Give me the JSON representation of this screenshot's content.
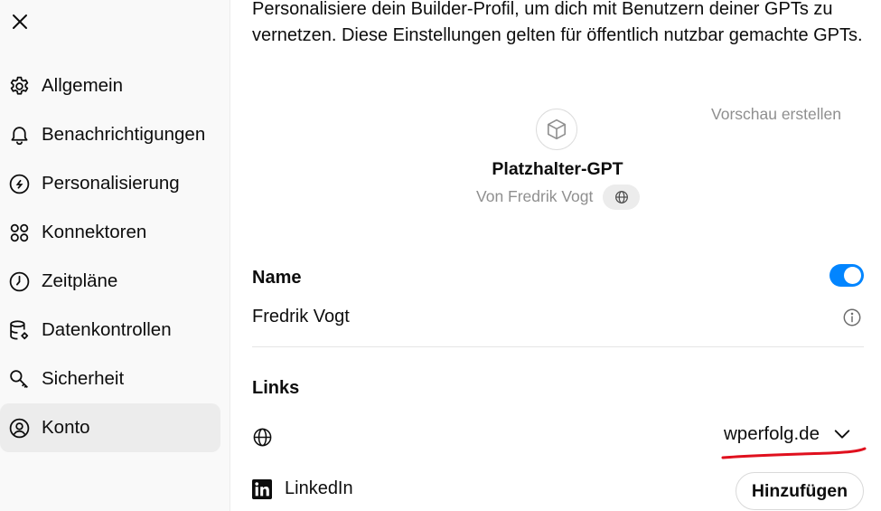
{
  "dialog": {
    "close_icon": "close-icon"
  },
  "sidebar": {
    "items": [
      {
        "label": "Allgemein",
        "icon": "gear-icon"
      },
      {
        "label": "Benachrichtigungen",
        "icon": "bell-icon"
      },
      {
        "label": "Personalisierung",
        "icon": "personalization-icon"
      },
      {
        "label": "Konnektoren",
        "icon": "connectors-icon"
      },
      {
        "label": "Zeitpläne",
        "icon": "clock-icon"
      },
      {
        "label": "Datenkontrollen",
        "icon": "database-gear-icon"
      },
      {
        "label": "Sicherheit",
        "icon": "key-icon"
      },
      {
        "label": "Konto",
        "icon": "user-circle-icon",
        "active": true
      }
    ]
  },
  "main": {
    "intro": "Personalisiere dein Builder-Profil, um dich mit Benutzern deiner GPTs zu vernetzen. Diese Einstellungen gelten für öffentlich nutzbar gemachte GPTs.",
    "preview_link": "Vorschau erstellen",
    "gpt_preview": {
      "icon": "cube-icon",
      "title": "Platzhalter-GPT",
      "author": "Von Fredrik Vogt",
      "visibility_icon": "globe-icon"
    },
    "name_section": {
      "heading": "Name",
      "value": "Fredrik Vogt",
      "toggle_on": true,
      "info_icon": "info-icon"
    },
    "links_section": {
      "heading": "Links",
      "website": {
        "icon": "globe-icon",
        "selected": "wperfolg.de"
      },
      "linkedin": {
        "icon": "linkedin-icon",
        "label": "LinkedIn",
        "button": "Hinzufügen"
      }
    }
  },
  "colors": {
    "accent": "#0285ff",
    "annotation": "#e0101e",
    "muted_text": "#8f8f8f",
    "active_item_bg": "#ececec"
  }
}
